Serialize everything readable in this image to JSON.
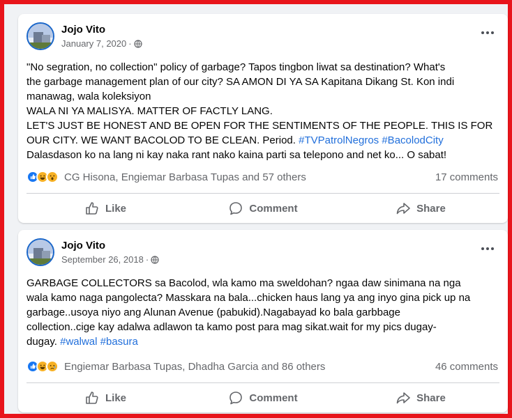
{
  "posts": [
    {
      "author": "Jojo Vito",
      "date": "January 7, 2020",
      "separator": "·",
      "text_lines": [
        "\"No segration, no collection\" policy of garbage? Tapos tingbon liwat sa destination? What's",
        "the garbage management plan of our city? SA AMON DI YA SA Kapitana Dikang St. Kon indi",
        "manawag, wala koleksiyon",
        "WALA NI YA MALISYA. MATTER OF FACTLY LANG.",
        "LET'S JUST BE HONEST AND BE OPEN FOR THE SENTIMENTS OF THE PEOPLE. THIS IS FOR",
        "OUR CITY. WE WANT BACOLOD TO BE CLEAN. Period.",
        "Dalasdason ko na lang ni kay naka rant nako kaina parti sa telepono and net ko... O sabat!"
      ],
      "hashtags": [
        "#TVPatrolNegros",
        "#BacolodCity"
      ],
      "reaction_names": "CG Hisona, Engiemar Barbasa Tupas and 57 others",
      "comments": "17 comments",
      "actions": {
        "like": "Like",
        "comment": "Comment",
        "share": "Share"
      }
    },
    {
      "author": "Jojo Vito",
      "date": "September 26, 2018",
      "separator": "·",
      "text_lines": [
        "GARBAGE COLLECTORS sa Bacolod, wla kamo ma sweldohan? ngaa daw sinimana na nga",
        "wala kamo naga pangolecta? Masskara na bala...chicken haus lang ya ang inyo gina pick up na",
        "garbage..usoya niyo ang Alunan Avenue (pabukid).Nagabayad ko bala garbbage",
        "collection..cige kay adalwa adlawon ta kamo post para mag sikat.wait for my pics dugay-",
        "dugay."
      ],
      "hashtags": [
        "#walwal",
        "#basura"
      ],
      "reaction_names": "Engiemar Barbasa Tupas, Dhadha Garcia and 86 others",
      "comments": "46 comments",
      "actions": {
        "like": "Like",
        "comment": "Comment",
        "share": "Share"
      }
    }
  ],
  "colors": {
    "frame_border": "#e8141b",
    "hashtag": "#216fdb",
    "like_reaction": "#1877f2",
    "muted_text": "#65676b"
  },
  "icons": {
    "audience": "globe-icon",
    "more": "more-options-icon",
    "like": "thumbs-up-icon",
    "comment": "speech-bubble-icon",
    "share": "share-arrow-icon"
  }
}
